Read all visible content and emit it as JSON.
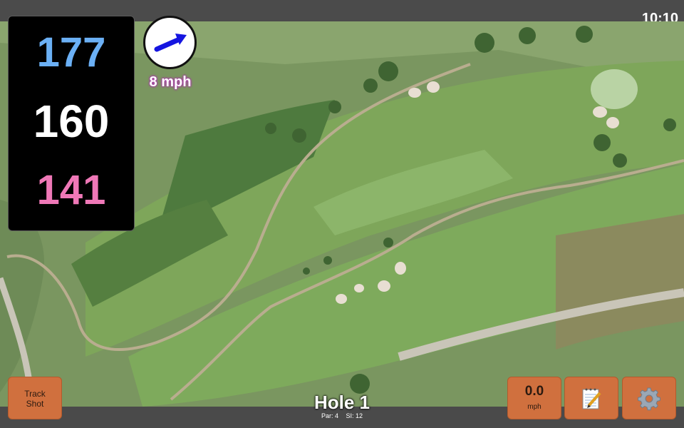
{
  "status_bar": {
    "time": "10:10"
  },
  "yardages": {
    "back": "177",
    "middle": "160",
    "front": "141"
  },
  "wind": {
    "speed_label": "8 mph",
    "direction_icon": "arrow-icon"
  },
  "buttons": {
    "track_shot": "Track\nShot",
    "speed_value": "0.0",
    "speed_unit": "mph",
    "notes_icon": "notepad-icon",
    "settings_icon": "gear-icon"
  },
  "hole": {
    "title": "Hole 1",
    "par": "Par: 4",
    "si": "SI: 12"
  },
  "colors": {
    "back_yardage": "#6bb0f5",
    "middle_yardage": "#ffffff",
    "front_yardage": "#ef78b7",
    "button": "#d0703e",
    "wind_arrow": "#1515e0"
  }
}
